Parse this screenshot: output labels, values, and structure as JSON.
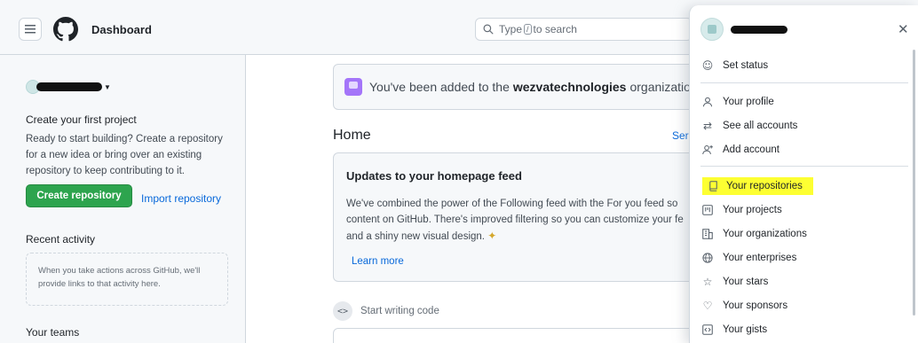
{
  "header": {
    "title": "Dashboard",
    "search_prefix": "Type",
    "search_key": "/",
    "search_suffix": "to search"
  },
  "sidebar": {
    "create_heading": "Create your first project",
    "create_text": "Ready to start building? Create a repository for a new idea or bring over an existing repository to keep contributing to it.",
    "create_button": "Create repository",
    "import_link": "Import repository",
    "recent_heading": "Recent activity",
    "recent_empty": "When you take actions across GitHub, we'll provide links to that activity here.",
    "teams_heading": "Your teams"
  },
  "main": {
    "banner_prefix": "You've been added to the",
    "banner_org": "wezvatechnologies",
    "banner_suffix": "organization.",
    "home_title": "Home",
    "see_link": "Ser",
    "feed_title": "Updates to your homepage feed",
    "feed_line1": "We've combined the power of the Following feed with the For you feed so",
    "feed_line2": "content on GitHub. There's improved filtering so you can customize your fe",
    "feed_line3": "and a shiny new visual design.",
    "learn_more": "Learn more",
    "start_writing": "Start writing code"
  },
  "panel": {
    "set_status": "Set status",
    "items_group1": [
      {
        "label": "Your profile",
        "icon": "person-icon"
      },
      {
        "label": "See all accounts",
        "icon": "arrow-switch-icon"
      },
      {
        "label": "Add account",
        "icon": "person-add-icon"
      }
    ],
    "items_group2": [
      {
        "label": "Your repositories",
        "icon": "repo-icon"
      },
      {
        "label": "Your projects",
        "icon": "project-icon"
      },
      {
        "label": "Your organizations",
        "icon": "organization-icon"
      },
      {
        "label": "Your enterprises",
        "icon": "globe-icon"
      },
      {
        "label": "Your stars",
        "icon": "star-icon"
      },
      {
        "label": "Your sponsors",
        "icon": "heart-icon"
      },
      {
        "label": "Your gists",
        "icon": "code-square-icon"
      }
    ],
    "highlight_color": "#fdff32"
  },
  "colors": {
    "primary_button": "#2da44e",
    "link": "#0969da",
    "org_icon": "#a475f9"
  }
}
